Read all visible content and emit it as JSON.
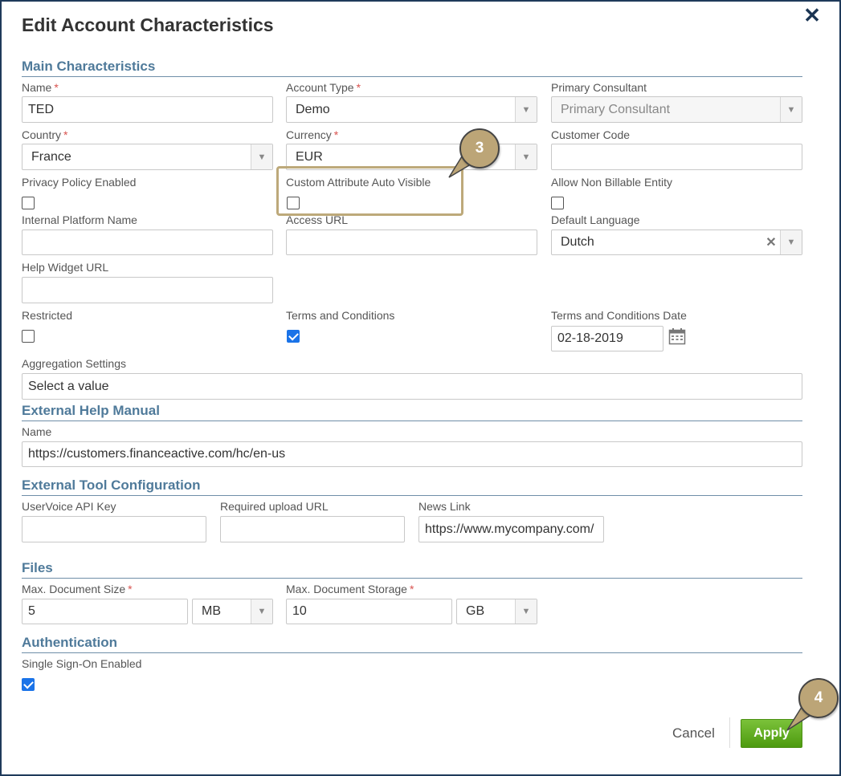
{
  "dialog": {
    "title": "Edit Account Characteristics",
    "close_icon": "close-icon"
  },
  "main": {
    "heading": "Main Characteristics",
    "name": {
      "label": "Name",
      "value": "TED"
    },
    "account_type": {
      "label": "Account Type",
      "value": "Demo"
    },
    "primary_consultant": {
      "label": "Primary Consultant",
      "placeholder": "Primary Consultant"
    },
    "country": {
      "label": "Country",
      "value": "France"
    },
    "currency": {
      "label": "Currency",
      "value": "EUR"
    },
    "customer_code": {
      "label": "Customer Code",
      "value": ""
    },
    "privacy_policy": {
      "label": "Privacy Policy Enabled",
      "checked": false
    },
    "custom_attr": {
      "label": "Custom Attribute Auto Visible",
      "checked": false
    },
    "allow_non_billable": {
      "label": "Allow Non Billable Entity",
      "checked": false
    },
    "internal_platform": {
      "label": "Internal Platform Name",
      "value": ""
    },
    "access_url": {
      "label": "Access URL",
      "value": ""
    },
    "default_language": {
      "label": "Default Language",
      "value": "Dutch"
    },
    "help_widget": {
      "label": "Help Widget URL",
      "value": ""
    },
    "restricted": {
      "label": "Restricted",
      "checked": false
    },
    "terms": {
      "label": "Terms and Conditions",
      "checked": true
    },
    "terms_date": {
      "label": "Terms and Conditions Date",
      "value": "02-18-2019"
    },
    "aggregation": {
      "label": "Aggregation Settings",
      "value": "Select a value"
    }
  },
  "help_manual": {
    "heading": "External Help Manual",
    "name": {
      "label": "Name",
      "value": "https://customers.financeactive.com/hc/en-us"
    }
  },
  "tools": {
    "heading": "External Tool Configuration",
    "uservoice": {
      "label": "UserVoice API Key",
      "value": ""
    },
    "upload_url": {
      "label": "Required upload URL",
      "value": ""
    },
    "news_link": {
      "label": "News Link",
      "value": "https://www.mycompany.com/"
    }
  },
  "files": {
    "heading": "Files",
    "max_doc_size": {
      "label": "Max. Document Size",
      "value": "5",
      "unit": "MB"
    },
    "max_doc_storage": {
      "label": "Max. Document Storage",
      "value": "10",
      "unit": "GB"
    }
  },
  "auth": {
    "heading": "Authentication",
    "sso": {
      "label": "Single Sign-On Enabled",
      "checked": true
    }
  },
  "footer": {
    "cancel": "Cancel",
    "apply": "Apply"
  },
  "callouts": {
    "step3": "3",
    "step4": "4"
  },
  "colors": {
    "section": "#4f7a9a",
    "apply": "#5aa81c",
    "callout": "#bca577",
    "required": "#d9534f"
  }
}
